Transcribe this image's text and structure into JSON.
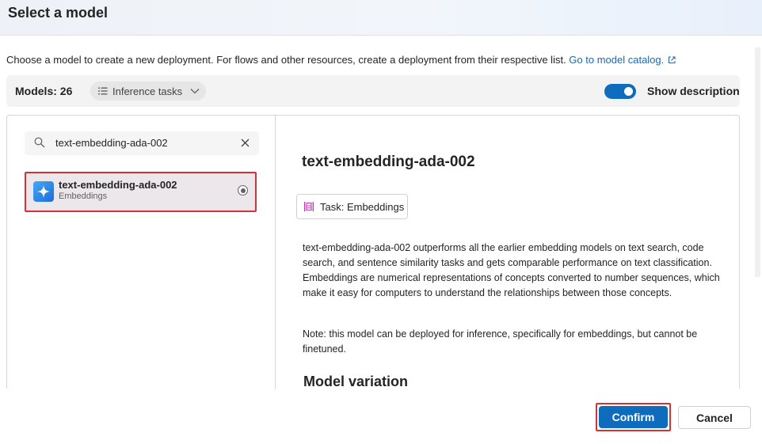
{
  "dialog": {
    "title": "Select a model"
  },
  "intro": {
    "text": "Choose a model to create a new deployment. For flows and other resources, create a deployment from their respective list. ",
    "link_label": "Go to model catalog.",
    "link_icon": "external-link-icon"
  },
  "toolbar": {
    "models_count": "Models: 26",
    "filter_label": "Inference tasks",
    "toggle_label": "Show description",
    "toggle_on": true,
    "accent_color": "#0f6cbd"
  },
  "search": {
    "value": "text-embedding-ada-002",
    "icons": [
      "search-icon",
      "clear-icon"
    ]
  },
  "model_list": [
    {
      "name": "text-embedding-ada-002",
      "category": "Embeddings",
      "selected": true,
      "icon": "sparkle-icon"
    }
  ],
  "detail": {
    "title": "text-embedding-ada-002",
    "task_chip": "Task: Embeddings",
    "description": "text-embedding-ada-002 outperforms all the earlier embedding models on text search, code search, and sentence similarity tasks and gets comparable performance on text classification. Embeddings are numerical representations of concepts converted to number sequences, which make it easy for computers to understand the relationships between those concepts.",
    "note": "Note: this model can be deployed for inference, specifically for embeddings, but cannot be finetuned.",
    "variation_heading": "Model variation"
  },
  "footer": {
    "confirm_label": "Confirm",
    "cancel_label": "Cancel",
    "highlight_color": "#d13438"
  }
}
